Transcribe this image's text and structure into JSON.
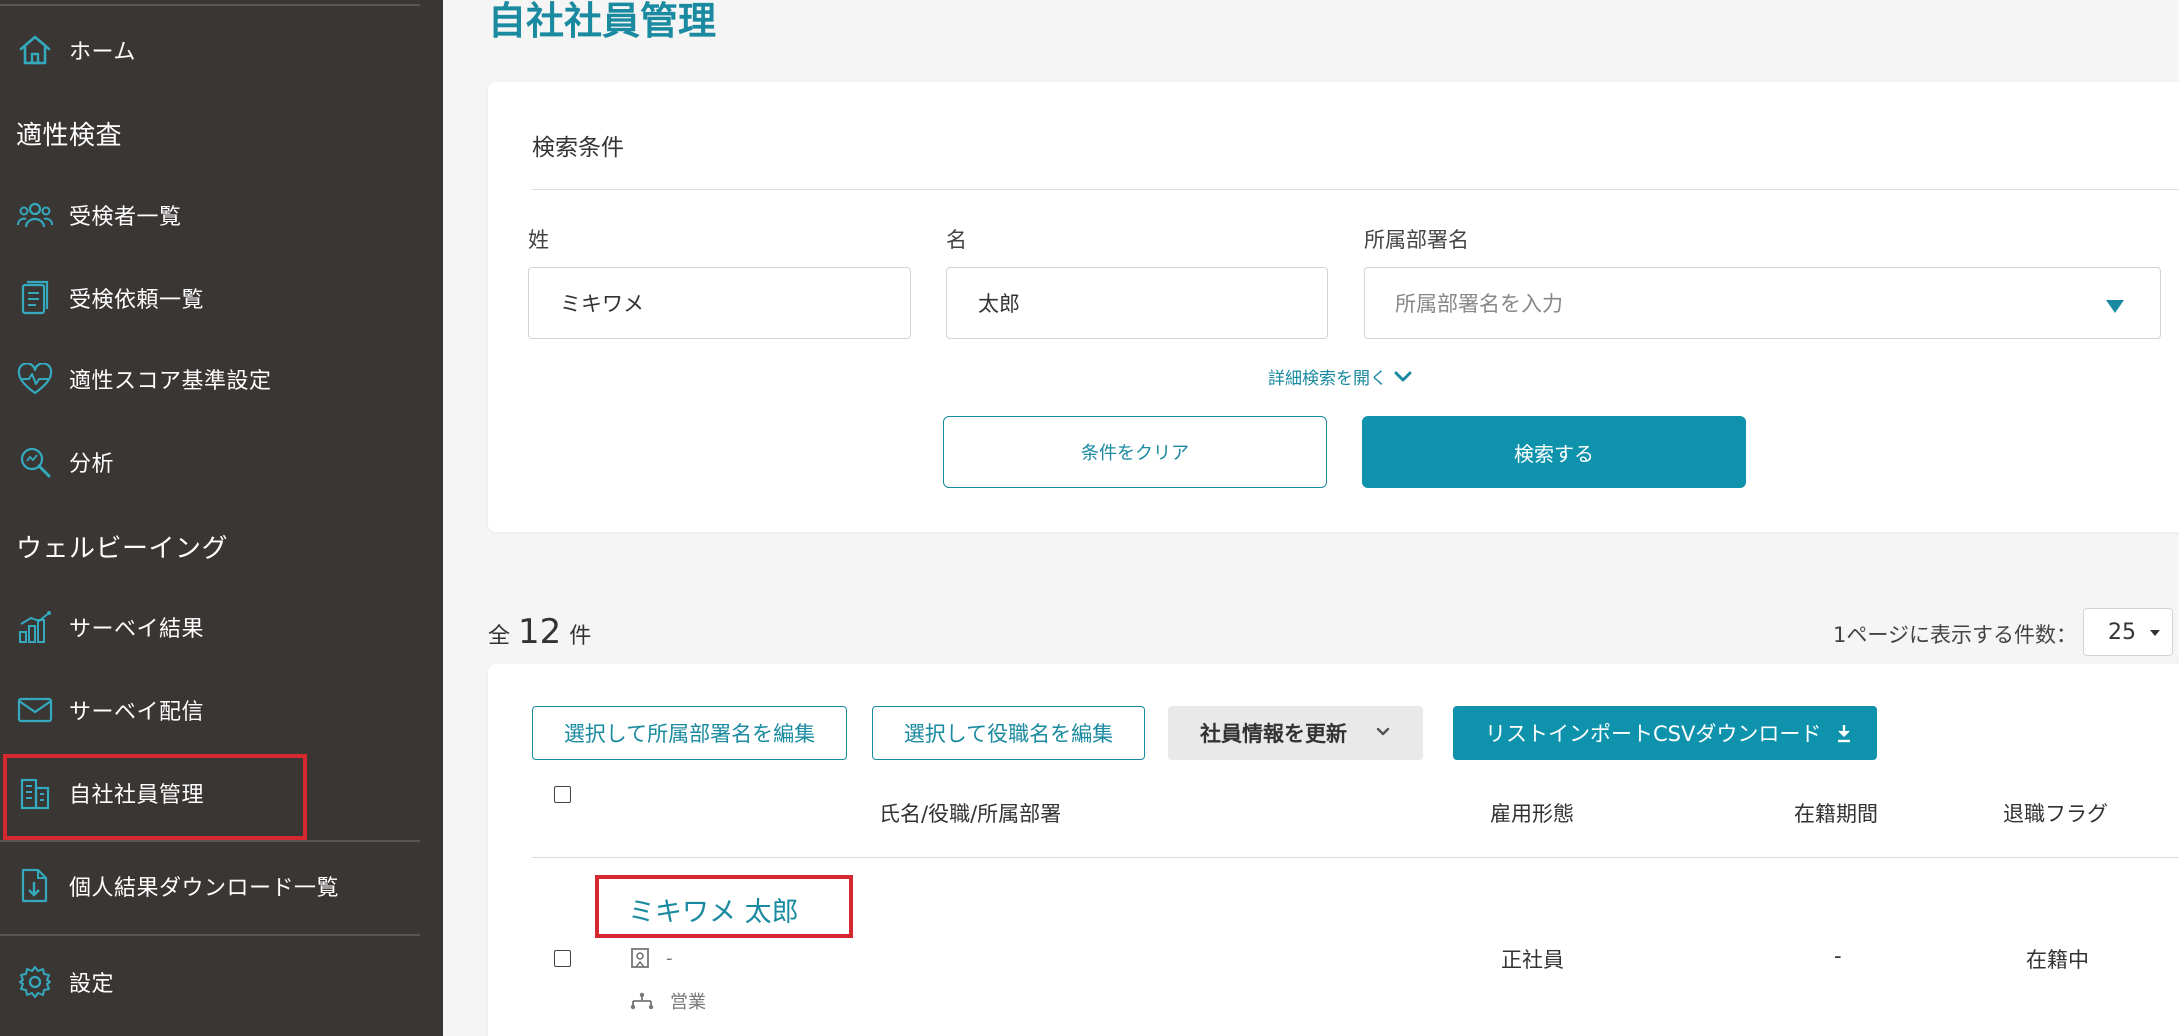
{
  "sidebar": {
    "home": "ホーム",
    "section_aptitude": "適性検査",
    "examinee_list": "受検者一覧",
    "request_list": "受検依頼一覧",
    "score_settings": "適性スコア基準設定",
    "analysis": "分析",
    "section_wellbeing": "ウェルビーイング",
    "survey_results": "サーベイ結果",
    "survey_delivery": "サーベイ配信",
    "employee_mgmt": "自社社員管理",
    "download_list": "個人結果ダウンロード一覧",
    "settings": "設定"
  },
  "page": {
    "title": "自社社員管理"
  },
  "search": {
    "heading": "検索条件",
    "last_name_label": "姓",
    "last_name_value": "ミキワメ",
    "first_name_label": "名",
    "first_name_value": "太郎",
    "dept_label": "所属部署名",
    "dept_placeholder": "所属部署名を入力",
    "advanced_link": "詳細検索を開く",
    "clear_button": "条件をクリア",
    "search_button": "検索する"
  },
  "results": {
    "count_prefix": "全",
    "count": "12",
    "count_suffix": "件",
    "per_page_label": "1ページに表示する件数：",
    "per_page_value": "25"
  },
  "actions": {
    "edit_dept": "選択して所属部署名を編集",
    "edit_title": "選択して役職名を編集",
    "update_info": "社員情報を更新",
    "csv_download": "リストインポートCSVダウンロード"
  },
  "table": {
    "headers": {
      "name": "氏名/役職/所属部署",
      "employment": "雇用形態",
      "tenure": "在籍期間",
      "retired": "退職フラグ"
    },
    "rows": [
      {
        "name": "ミキワメ 太郎",
        "title": "-",
        "dept": "営業",
        "employment": "正社員",
        "tenure": "-",
        "status": "在籍中"
      }
    ]
  },
  "colors": {
    "accent": "#0f93ad",
    "sidebar_bg": "#3a3634",
    "highlight": "#d6282f"
  }
}
